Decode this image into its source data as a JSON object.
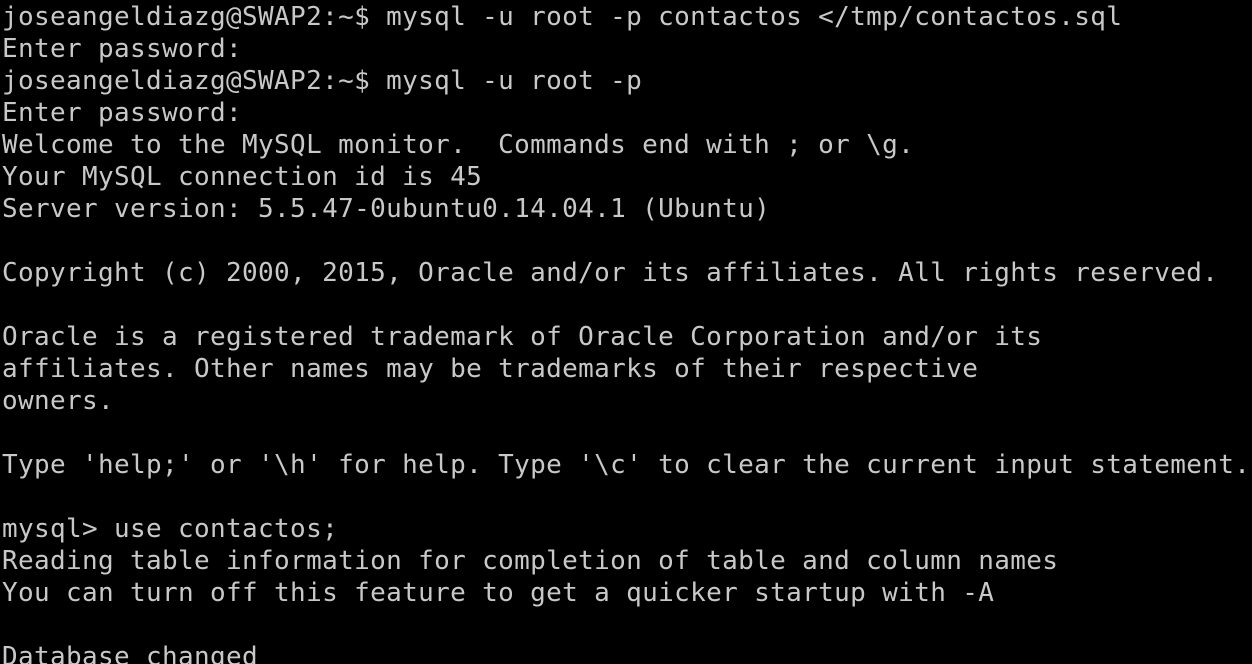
{
  "terminal": {
    "lines": [
      "joseangeldiazg@SWAP2:~$ mysql -u root -p contactos </tmp/contactos.sql",
      "Enter password:",
      "joseangeldiazg@SWAP2:~$ mysql -u root -p",
      "Enter password:",
      "Welcome to the MySQL monitor.  Commands end with ; or \\g.",
      "Your MySQL connection id is 45",
      "Server version: 5.5.47-0ubuntu0.14.04.1 (Ubuntu)",
      "",
      "Copyright (c) 2000, 2015, Oracle and/or its affiliates. All rights reserved.",
      "",
      "Oracle is a registered trademark of Oracle Corporation and/or its",
      "affiliates. Other names may be trademarks of their respective",
      "owners.",
      "",
      "Type 'help;' or '\\h' for help. Type '\\c' to clear the current input statement.",
      "",
      "mysql> use contactos;",
      "Reading table information for completion of table and column names",
      "You can turn off this feature to get a quicker startup with -A",
      "",
      "Database changed"
    ],
    "colors": {
      "background": "#000000",
      "foreground": "#c8c8c8"
    }
  }
}
